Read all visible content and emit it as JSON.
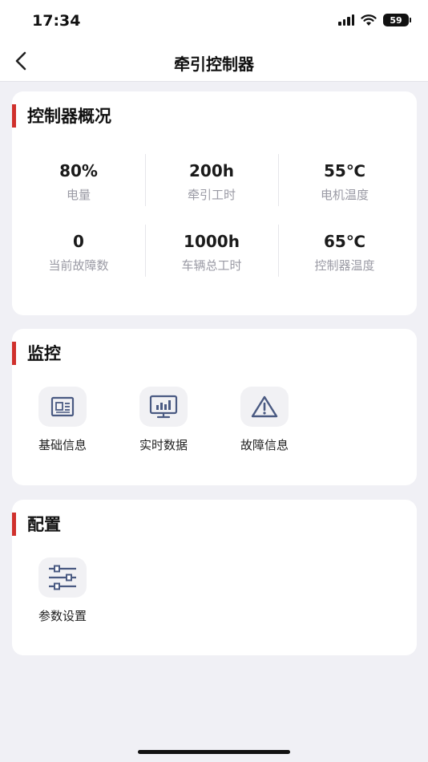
{
  "status_bar": {
    "time": "17:34",
    "battery": "59"
  },
  "nav": {
    "title": "牵引控制器"
  },
  "overview": {
    "title": "控制器概况",
    "rows": [
      [
        {
          "value": "80%",
          "label": "电量"
        },
        {
          "value": "200h",
          "label": "牵引工时"
        },
        {
          "value": "55℃",
          "label": "电机温度"
        }
      ],
      [
        {
          "value": "0",
          "label": "当前故障数"
        },
        {
          "value": "1000h",
          "label": "车辆总工时"
        },
        {
          "value": "65℃",
          "label": "控制器温度"
        }
      ]
    ]
  },
  "monitor": {
    "title": "监控",
    "items": [
      {
        "label": "基础信息",
        "icon": "document-icon"
      },
      {
        "label": "实时数据",
        "icon": "monitor-chart-icon"
      },
      {
        "label": "故障信息",
        "icon": "warning-icon"
      }
    ]
  },
  "config": {
    "title": "配置",
    "items": [
      {
        "label": "参数设置",
        "icon": "sliders-icon"
      }
    ]
  },
  "colors": {
    "accent": "#d0312d",
    "icon": "#4a5a82",
    "background": "#f0f0f5"
  }
}
